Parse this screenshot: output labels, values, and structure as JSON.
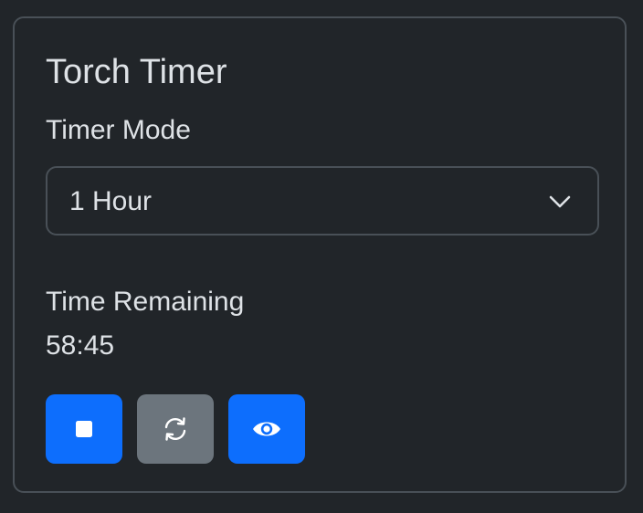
{
  "card": {
    "title": "Torch Timer",
    "mode_label": "Timer Mode",
    "mode_select": {
      "selected": "1 Hour",
      "icon": "chevron-down-icon"
    },
    "remaining_label": "Time Remaining",
    "remaining_value": "58:45",
    "buttons": [
      {
        "name": "stop",
        "icon": "stop-icon",
        "color": "#0d6efd"
      },
      {
        "name": "reset",
        "icon": "refresh-icon",
        "color": "#6c757d"
      },
      {
        "name": "view",
        "icon": "eye-icon",
        "color": "#0d6efd"
      }
    ]
  },
  "colors": {
    "background": "#212529",
    "border": "#495057",
    "text": "#dee2e6",
    "primary": "#0d6efd",
    "secondary": "#6c757d"
  }
}
